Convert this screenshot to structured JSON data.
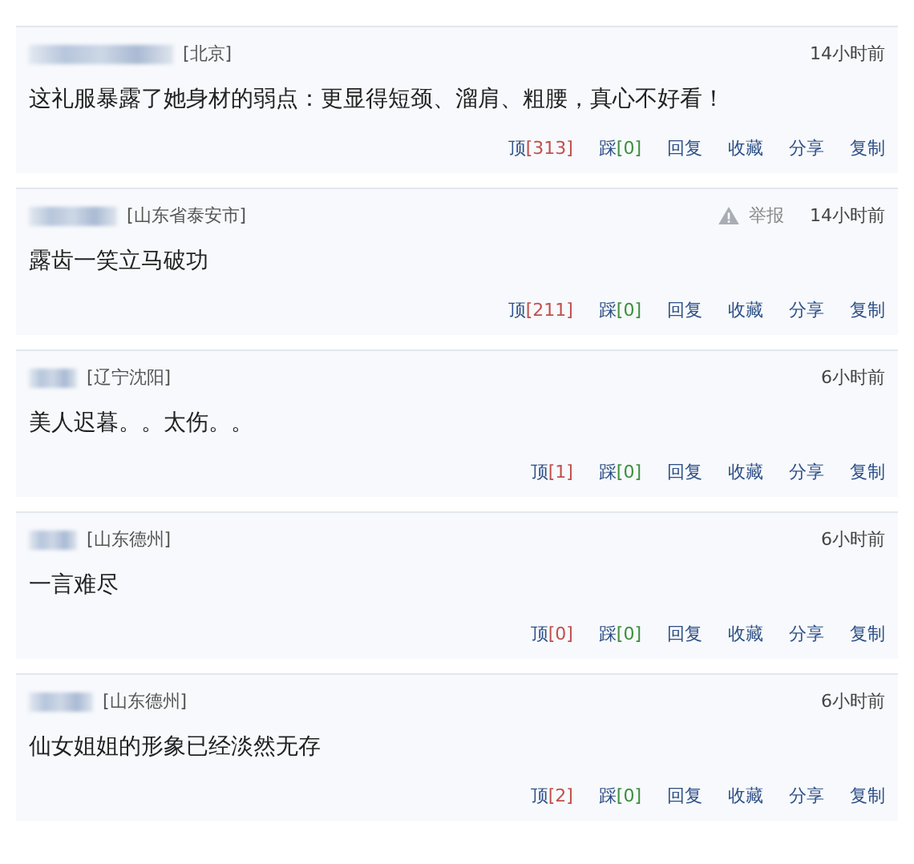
{
  "comments": [
    {
      "location": "[北京]",
      "time": "14小时前",
      "text": "这礼服暴露了她身材的弱点：更显得短颈、溜肩、粗腰，真心不好看！",
      "up": "顶",
      "up_count": "[313]",
      "down": "踩",
      "down_count": "[0]",
      "actions": [
        "回复",
        "收藏",
        "分享",
        "复制"
      ]
    },
    {
      "location": "[山东省泰安市]",
      "report": "举报",
      "time": "14小时前",
      "text": "露齿一笑立马破功",
      "up": "顶",
      "up_count": "[211]",
      "down": "踩",
      "down_count": "[0]",
      "actions": [
        "回复",
        "收藏",
        "分享",
        "复制"
      ]
    },
    {
      "location": "[辽宁沈阳]",
      "time": "6小时前",
      "text": "美人迟暮。。太伤。。",
      "up": "顶",
      "up_count": "[1]",
      "down": "踩",
      "down_count": "[0]",
      "actions": [
        "回复",
        "收藏",
        "分享",
        "复制"
      ]
    },
    {
      "location": "[山东德州]",
      "time": "6小时前",
      "text": "一言难尽",
      "up": "顶",
      "up_count": "[0]",
      "down": "踩",
      "down_count": "[0]",
      "actions": [
        "回复",
        "收藏",
        "分享",
        "复制"
      ]
    },
    {
      "location": "[山东德州]",
      "time": "6小时前",
      "text": "仙女姐姐的形象已经淡然无存",
      "up": "顶",
      "up_count": "[2]",
      "down": "踩",
      "down_count": "[0]",
      "actions": [
        "回复",
        "收藏",
        "分享",
        "复制"
      ]
    }
  ]
}
